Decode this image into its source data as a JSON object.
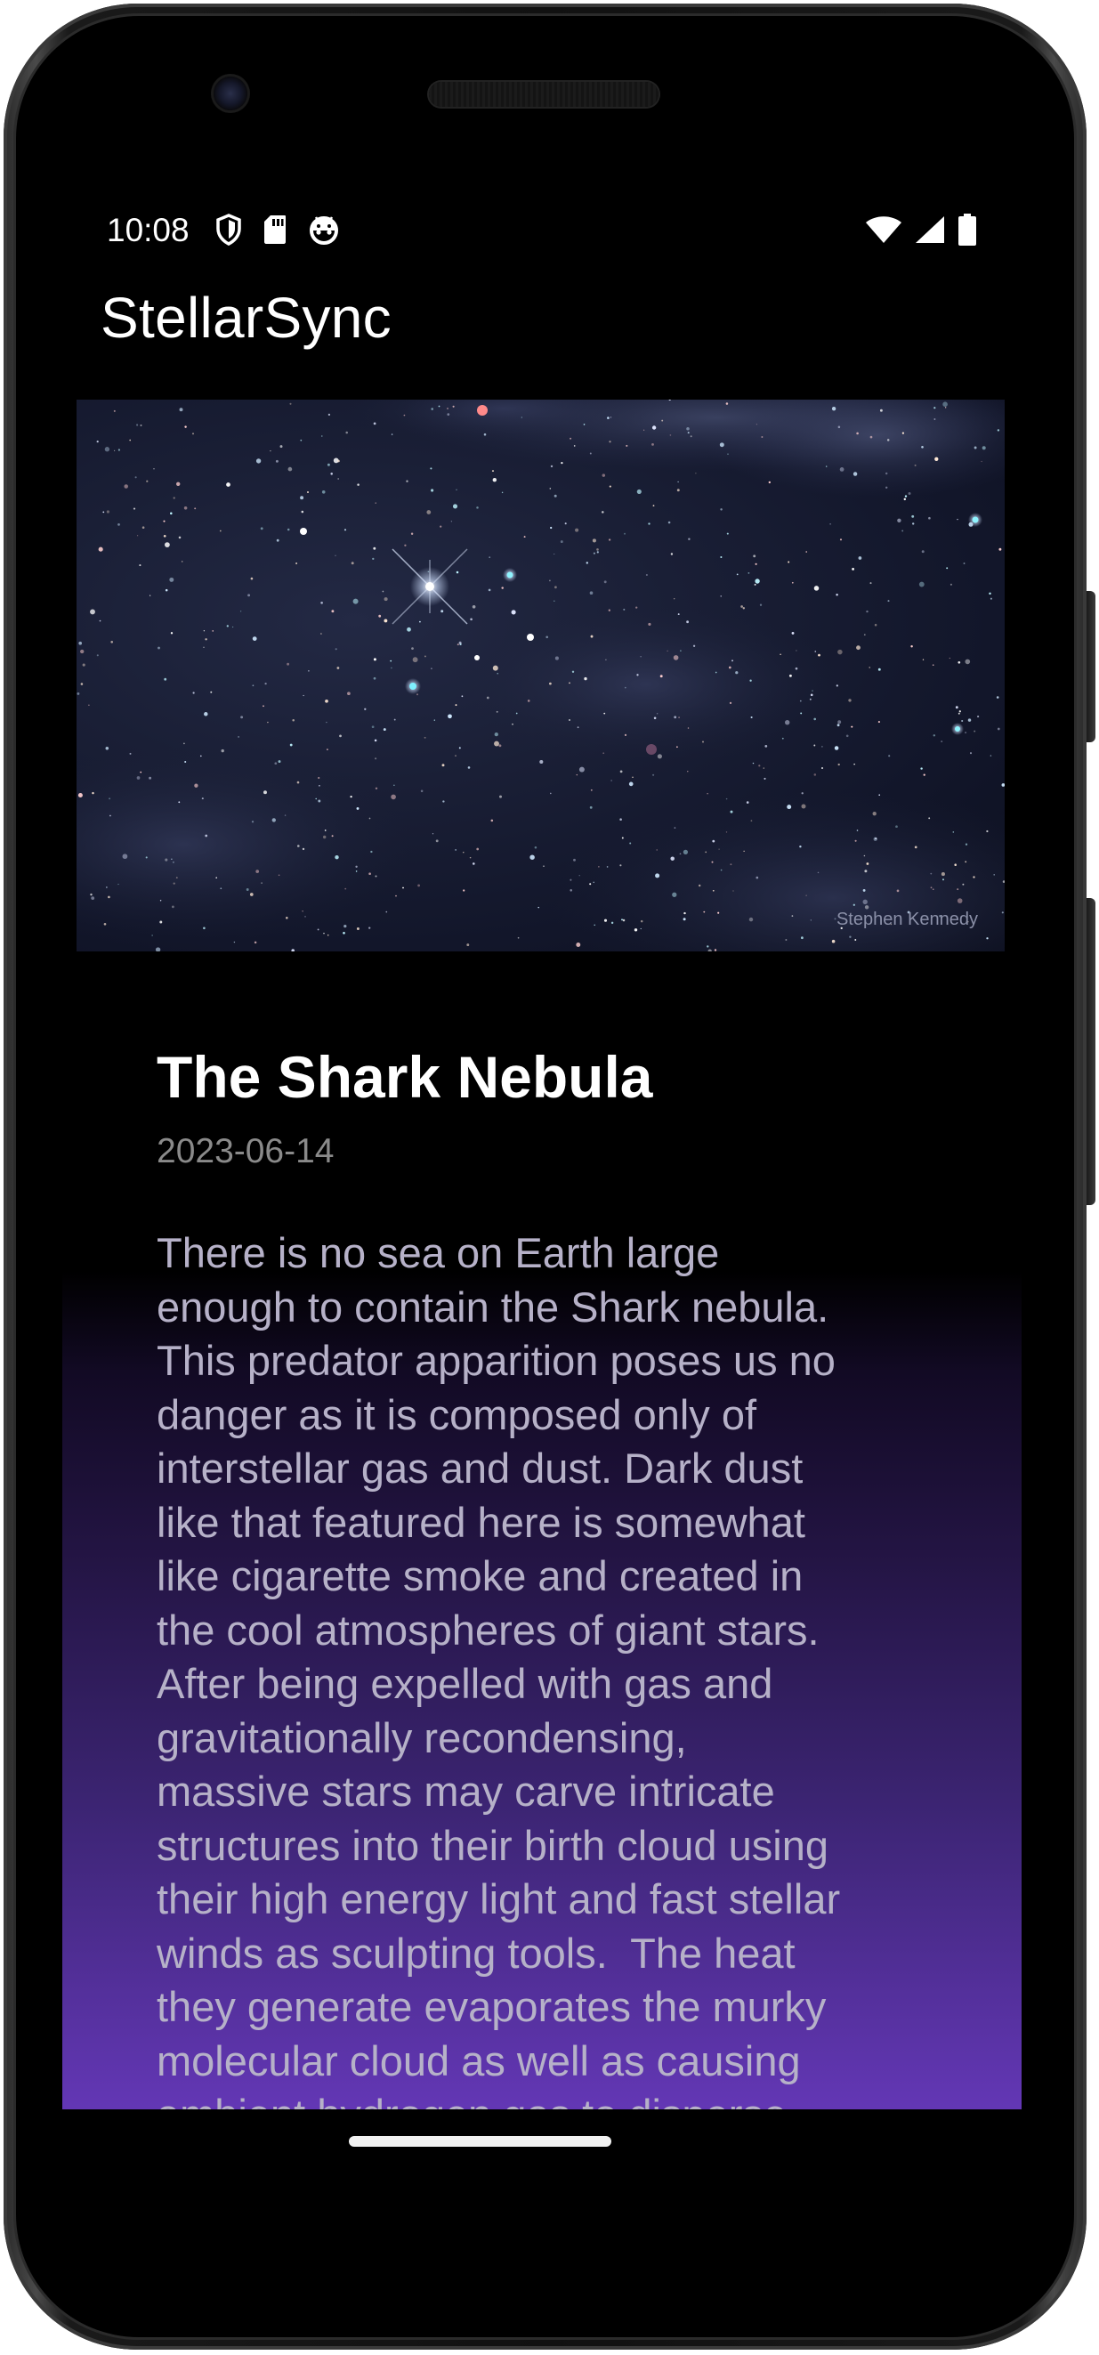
{
  "status_bar": {
    "time": "10:08",
    "left_icons": [
      "shield-icon",
      "sd-card-icon",
      "android-debug-icon"
    ],
    "right_icons": [
      "wifi-icon",
      "signal-icon",
      "battery-icon"
    ]
  },
  "app_bar": {
    "title": "StellarSync"
  },
  "hero_image": {
    "alt_subject": "starfield",
    "credit": "Stephen Kennedy"
  },
  "article": {
    "title": "The Shark Nebula",
    "date": "2023-06-14",
    "body": "There is no sea on Earth large\nenough to contain the Shark nebula.\nThis predator apparition poses us no\ndanger as it is composed only of\ninterstellar gas and dust. Dark dust\nlike that featured here is somewhat\nlike cigarette smoke and created in\nthe cool atmospheres of giant stars.\nAfter being expelled with gas and\ngravitationally recondensing,\nmassive stars may carve intricate\nstructures into their birth cloud using\ntheir high energy light and fast stellar\nwinds as sculpting tools.  The heat\nthey generate evaporates the murky\nmolecular cloud as well as causing\nambient hydrogen gas to disperse"
  },
  "colors": {
    "background": "#000000",
    "gradient_end": "#6337b5",
    "title_text": "#ffffff",
    "date_text": "#8a8a8a",
    "body_text": "#b6b1c8"
  }
}
